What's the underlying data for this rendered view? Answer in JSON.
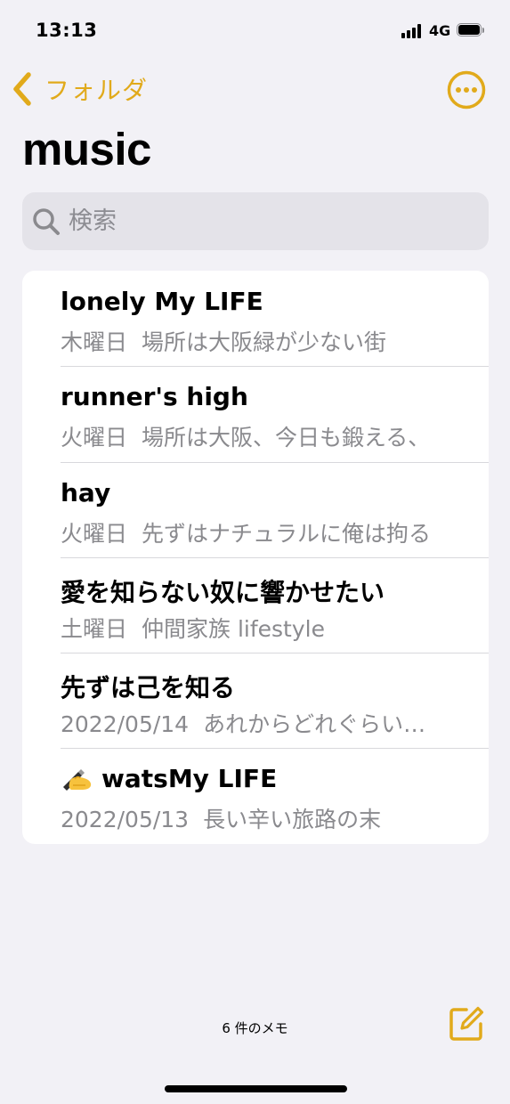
{
  "status_bar": {
    "time": "13:13",
    "network": "4G",
    "icons": [
      "signal-icon",
      "battery-icon"
    ]
  },
  "nav": {
    "back_label": "フォルダ",
    "back_icon": "chevron-left-icon",
    "more_icon": "ellipsis-circle-icon",
    "accent_color": "#e1aa1b"
  },
  "folder_title": "music",
  "search": {
    "placeholder": "検索",
    "value": ""
  },
  "notes": [
    {
      "title": "lonely My LIFE",
      "date": "木曜日",
      "preview": "場所は大阪緑が少ない街"
    },
    {
      "title": "runner's high",
      "date": "火曜日",
      "preview": "場所は大阪、今日も鍛える、"
    },
    {
      "title": "hay",
      "date": "火曜日",
      "preview": "先ずはナチュラルに俺は拘る"
    },
    {
      "title": "愛を知らない奴に響かせたい",
      "date": "土曜日",
      "preview": "仲間家族 lifestyle"
    },
    {
      "title": "先ずは己を知る",
      "date": "2022/05/14",
      "preview": "あれからどれぐらい…"
    },
    {
      "title": "watsMy LIFE",
      "title_icon": "writing-hand-emoji",
      "date": "2022/05/13",
      "preview": "長い辛い旅路の末"
    }
  ],
  "footer": {
    "note_count": "6 件のメモ",
    "compose_icon": "compose-icon"
  }
}
